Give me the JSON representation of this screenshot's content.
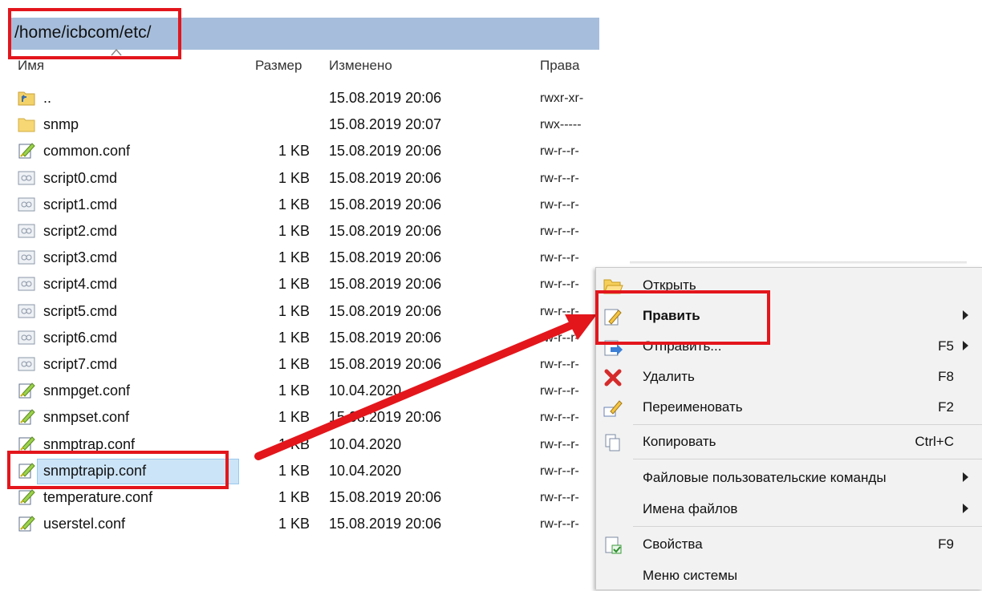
{
  "path": "/home/icbcom/etc/",
  "columns": {
    "name": "Имя",
    "size": "Размер",
    "modified": "Изменено",
    "rights": "Права"
  },
  "files": [
    {
      "name": "..",
      "size": "",
      "date": "15.08.2019 20:06",
      "rights": "rwxr-xr-",
      "icon": "parent-folder-icon"
    },
    {
      "name": "snmp",
      "size": "",
      "date": "15.08.2019 20:07",
      "rights": "rwx-----",
      "icon": "folder-icon"
    },
    {
      "name": "common.conf",
      "size": "1 KB",
      "date": "15.08.2019 20:06",
      "rights": "rw-r--r-",
      "icon": "conf-file-icon"
    },
    {
      "name": "script0.cmd",
      "size": "1 KB",
      "date": "15.08.2019 20:06",
      "rights": "rw-r--r-",
      "icon": "cmd-file-icon"
    },
    {
      "name": "script1.cmd",
      "size": "1 KB",
      "date": "15.08.2019 20:06",
      "rights": "rw-r--r-",
      "icon": "cmd-file-icon"
    },
    {
      "name": "script2.cmd",
      "size": "1 KB",
      "date": "15.08.2019 20:06",
      "rights": "rw-r--r-",
      "icon": "cmd-file-icon"
    },
    {
      "name": "script3.cmd",
      "size": "1 KB",
      "date": "15.08.2019 20:06",
      "rights": "rw-r--r-",
      "icon": "cmd-file-icon"
    },
    {
      "name": "script4.cmd",
      "size": "1 KB",
      "date": "15.08.2019 20:06",
      "rights": "rw-r--r-",
      "icon": "cmd-file-icon"
    },
    {
      "name": "script5.cmd",
      "size": "1 KB",
      "date": "15.08.2019 20:06",
      "rights": "rw-r--r-",
      "icon": "cmd-file-icon"
    },
    {
      "name": "script6.cmd",
      "size": "1 KB",
      "date": "15.08.2019 20:06",
      "rights": "rw-r--r-",
      "icon": "cmd-file-icon"
    },
    {
      "name": "script7.cmd",
      "size": "1 KB",
      "date": "15.08.2019 20:06",
      "rights": "rw-r--r-",
      "icon": "cmd-file-icon"
    },
    {
      "name": "snmpget.conf",
      "size": "1 KB",
      "date": "10.04.2020",
      "rights": "rw-r--r-",
      "icon": "conf-file-icon"
    },
    {
      "name": "snmpset.conf",
      "size": "1 KB",
      "date": "15.08.2019 20:06",
      "rights": "rw-r--r-",
      "icon": "conf-file-icon"
    },
    {
      "name": "snmptrap.conf",
      "size": "1 KB",
      "date": "10.04.2020",
      "rights": "rw-r--r-",
      "icon": "conf-file-icon"
    },
    {
      "name": "snmptrapip.conf",
      "size": "1 KB",
      "date": "10.04.2020",
      "rights": "rw-r--r-",
      "icon": "conf-file-icon",
      "selected": true
    },
    {
      "name": "temperature.conf",
      "size": "1 KB",
      "date": "15.08.2019 20:06",
      "rights": "rw-r--r-",
      "icon": "conf-file-icon"
    },
    {
      "name": "userstel.conf",
      "size": "1 KB",
      "date": "15.08.2019 20:06",
      "rights": "rw-r--r-",
      "icon": "conf-file-icon"
    }
  ],
  "context_menu": {
    "items": [
      {
        "label": "Открыть",
        "key": "",
        "submenu": false,
        "icon": "open-folder-icon"
      },
      {
        "label": "Править",
        "key": "",
        "submenu": true,
        "icon": "edit-icon",
        "bold": true
      },
      {
        "label": "Отправить...",
        "key": "F5",
        "submenu": true,
        "icon": "send-icon"
      },
      {
        "label": "Удалить",
        "key": "F8",
        "submenu": false,
        "icon": "delete-icon"
      },
      {
        "label": "Переименовать",
        "key": "F2",
        "submenu": false,
        "icon": "rename-icon"
      },
      {
        "label": "Копировать",
        "key": "Ctrl+C",
        "submenu": false,
        "icon": "copy-icon"
      },
      {
        "label": "Файловые пользовательские команды",
        "key": "",
        "submenu": true,
        "icon": ""
      },
      {
        "label": "Имена файлов",
        "key": "",
        "submenu": true,
        "icon": ""
      },
      {
        "label": "Свойства",
        "key": "F9",
        "submenu": false,
        "icon": "properties-icon"
      },
      {
        "label": "Меню системы",
        "key": "",
        "submenu": false,
        "icon": ""
      }
    ]
  },
  "colors": {
    "highlight": "#e3161c",
    "path_bar": "#a6bedb",
    "selection": "#cce4f7"
  }
}
